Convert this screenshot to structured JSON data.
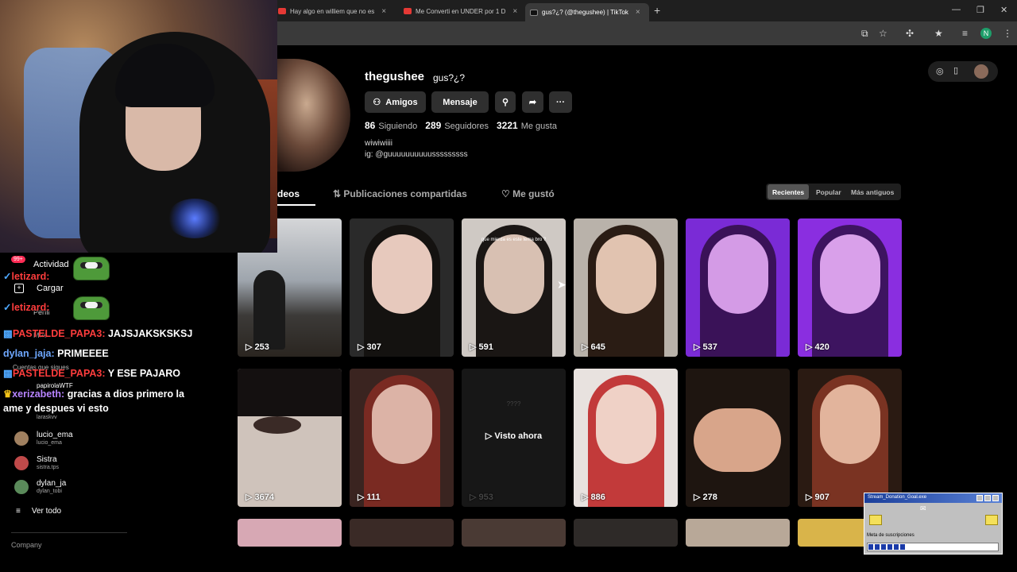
{
  "browser": {
    "tabs": [
      {
        "label": "Hay algo en williem que no es"
      },
      {
        "label": "Me Converti en UNDER por 1 D"
      },
      {
        "label": "gus?¿? (@thegushee) | TikTok"
      }
    ]
  },
  "sidebar": {
    "badge": "99+",
    "items": [
      {
        "label": "Actividad"
      },
      {
        "label": "Cargar"
      },
      {
        "label": "Perfil"
      },
      {
        "label": "Más"
      }
    ],
    "following_heading": "Cuentas que sigues",
    "friends": [
      {
        "name": "papirolaWTF",
        "user": ""
      },
      {
        "name": "",
        "user": "laraskvv"
      },
      {
        "name": "lucio_ema",
        "user": "lucio_ema"
      },
      {
        "name": "Sistra",
        "user": "sistra.tps"
      },
      {
        "name": "dylan_ja",
        "user": "dylan_tobi"
      }
    ],
    "see_all": "Ver todo",
    "company": "Company"
  },
  "chat": {
    "messages": [
      {
        "user": "letizard:",
        "text": "",
        "color": "#ff3d3d"
      },
      {
        "user": "letizard:",
        "text": "",
        "color": "#ff3d3d"
      },
      {
        "user": "PASTELDE_PAPA3:",
        "text": "JAJSJAKSKSKSJ",
        "color": "#ff3d3d"
      },
      {
        "user": "dylan_jaja:",
        "text": "PRIMEEEE",
        "color": "#6fa8ff"
      },
      {
        "user": "PASTELDE_PAPA3:",
        "text": "Y ESE PAJARO",
        "color": "#ff3d3d"
      },
      {
        "user": "xerizabeth:",
        "text": "gracias a dios primero la",
        "color": "#b784ff"
      }
    ],
    "continuation": "ame y despues vi esto"
  },
  "profile": {
    "username": "thegushee",
    "nickname": "gus?¿?",
    "buttons": {
      "friends": "Amigos",
      "message": "Mensaje"
    },
    "stats": {
      "following": "86",
      "following_label": "Siguiendo",
      "followers": "289",
      "followers_label": "Seguidores",
      "likes": "3221",
      "likes_label": "Me gusta"
    },
    "bio_line1": "wiwiwiiii",
    "bio_line2": "ig: @guuuuuuuuuusssssssss"
  },
  "tabs": {
    "videos": "deos",
    "reposts": "Publicaciones compartidas",
    "liked": "Me gustó"
  },
  "sort": {
    "recent": "Recientes",
    "popular": "Popular",
    "oldest": "Más antiguos"
  },
  "videos": [
    {
      "views": "253"
    },
    {
      "views": "307"
    },
    {
      "views": "591",
      "caption": "que mierda es este tema bro ?"
    },
    {
      "views": "645"
    },
    {
      "views": "537"
    },
    {
      "views": "420"
    },
    {
      "views": "3674"
    },
    {
      "views": "111"
    },
    {
      "views": "953",
      "watched": "Visto ahora",
      "placeholder": "????"
    },
    {
      "views": "886"
    },
    {
      "views": "278"
    },
    {
      "views": "907"
    }
  ],
  "donation": {
    "title": "Stream_Donation_Goal.exe",
    "goal_label": "Meta de suscripciones",
    "progress": 0.3
  },
  "colors": {
    "accent": "#fe2c55",
    "background": "#000000",
    "button": "#2f2f2f"
  }
}
